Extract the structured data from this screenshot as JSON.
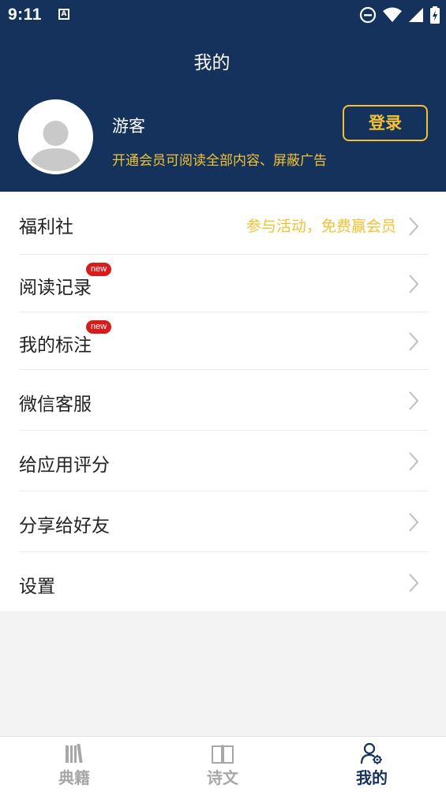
{
  "status_bar": {
    "time": "9:11",
    "notification_icon": "A"
  },
  "header": {
    "title": "我的",
    "username": "游客",
    "vip_tip": "开通会员可阅读全部内容、屏蔽广告",
    "login_label": "登录"
  },
  "menu": {
    "items": [
      {
        "label": "福利社",
        "sub": "参与活动，免费赢会员",
        "badge": ""
      },
      {
        "label": "阅读记录",
        "sub": "",
        "badge": "new"
      },
      {
        "label": "我的标注",
        "sub": "",
        "badge": "new"
      },
      {
        "label": "微信客服",
        "sub": "",
        "badge": ""
      },
      {
        "label": "给应用评分",
        "sub": "",
        "badge": ""
      },
      {
        "label": "分享给好友",
        "sub": "",
        "badge": ""
      },
      {
        "label": "设置",
        "sub": "",
        "badge": ""
      }
    ]
  },
  "tabbar": {
    "tabs": [
      {
        "label": "典籍",
        "icon": "books-icon"
      },
      {
        "label": "诗文",
        "icon": "open-book-icon"
      },
      {
        "label": "我的",
        "icon": "user-gear-icon"
      }
    ],
    "active_index": 2
  },
  "colors": {
    "primary": "#14325c",
    "accent": "#f2c232",
    "badge": "#d81b1b"
  }
}
